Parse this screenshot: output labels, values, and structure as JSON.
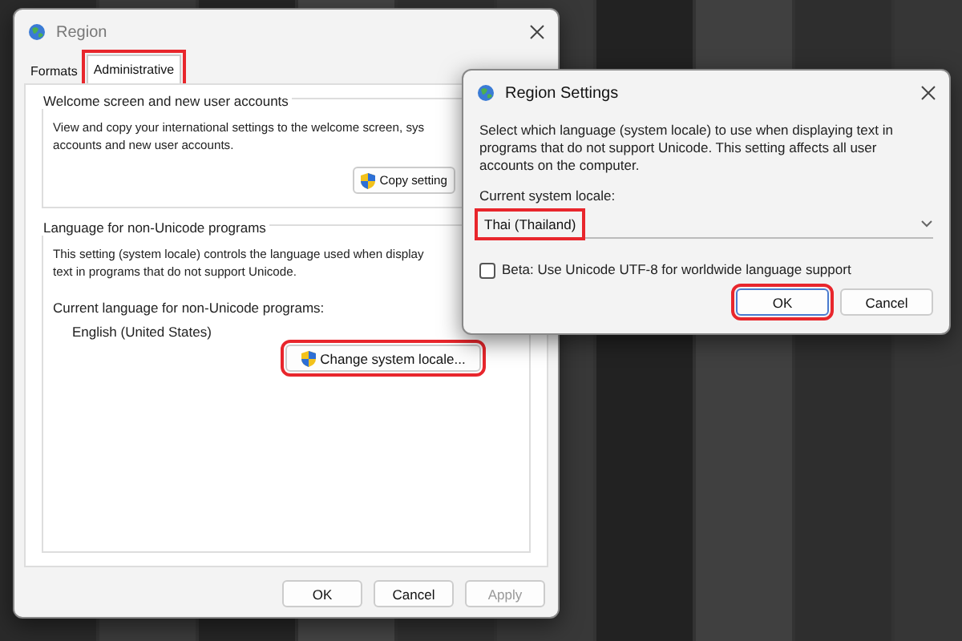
{
  "region_window": {
    "title": "Region",
    "tabs": [
      {
        "label": "Formats",
        "selected": false,
        "highlighted": false
      },
      {
        "label": "Administrative",
        "selected": true,
        "highlighted": true
      }
    ],
    "welcome_group": {
      "title": "Welcome screen and new user accounts",
      "lines": [
        "View and copy your international settings to the welcome screen, sys",
        "accounts and new user accounts."
      ],
      "button": {
        "label": "Copy setting",
        "highlighted": false
      }
    },
    "unicode_group": {
      "title": "Language for non-Unicode programs",
      "lines": [
        "This setting (system locale) controls the language used when display",
        "text in programs that do not support Unicode."
      ],
      "current_label": "Current language for non-Unicode programs:",
      "current_value": "English (United States)",
      "button": {
        "label": "Change system locale...",
        "highlighted": true
      }
    },
    "buttons": [
      {
        "label": "OK",
        "disabled": false
      },
      {
        "label": "Cancel",
        "disabled": false
      },
      {
        "label": "Apply",
        "disabled": true
      }
    ]
  },
  "settings_dialog": {
    "title": "Region Settings",
    "description": "Select which language (system locale) to use when displaying text in programs that do not support Unicode. This setting affects all user accounts on the computer.",
    "locale_label": "Current system locale:",
    "locale": {
      "value": "Thai (Thailand)",
      "highlighted": true
    },
    "beta": {
      "label": "Beta: Use Unicode UTF-8 for worldwide language support",
      "checked": false
    },
    "buttons": [
      {
        "label": "OK",
        "highlighted": true,
        "default": true
      },
      {
        "label": "Cancel",
        "highlighted": false,
        "default": false
      }
    ]
  }
}
